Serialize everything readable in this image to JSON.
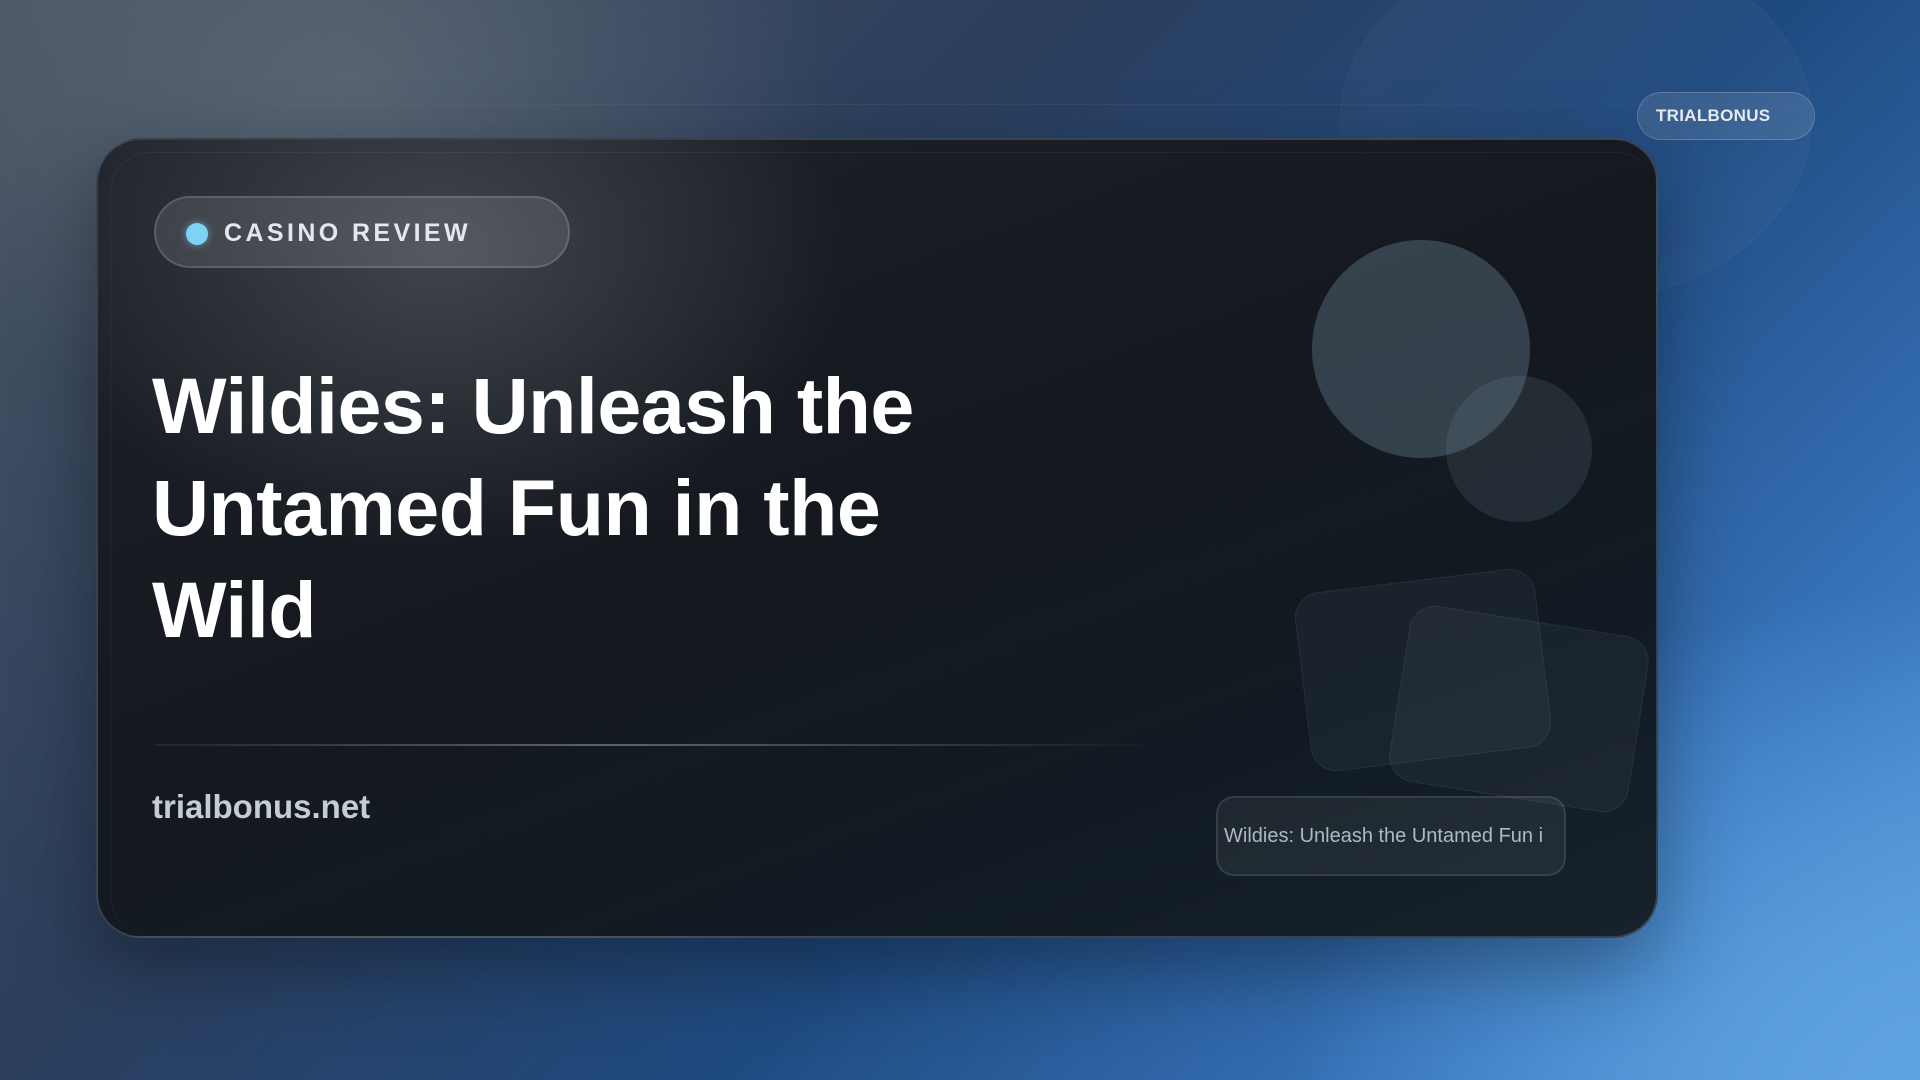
{
  "brand_badge": {
    "label": "TRIALBONUS"
  },
  "card": {
    "tag": {
      "label": "CASINO REVIEW",
      "dot_color": "#7fd2f4"
    },
    "title": "Wildies: Unleash the Untamed Fun in the Wild",
    "domain": "trialbonus.net",
    "caption": "Wildies: Unleash the Untamed Fun i"
  },
  "colors": {
    "background_start": "#4a5563",
    "background_end": "#5a9ddc",
    "card_background": "#15191f",
    "title_text": "#ffffff"
  }
}
